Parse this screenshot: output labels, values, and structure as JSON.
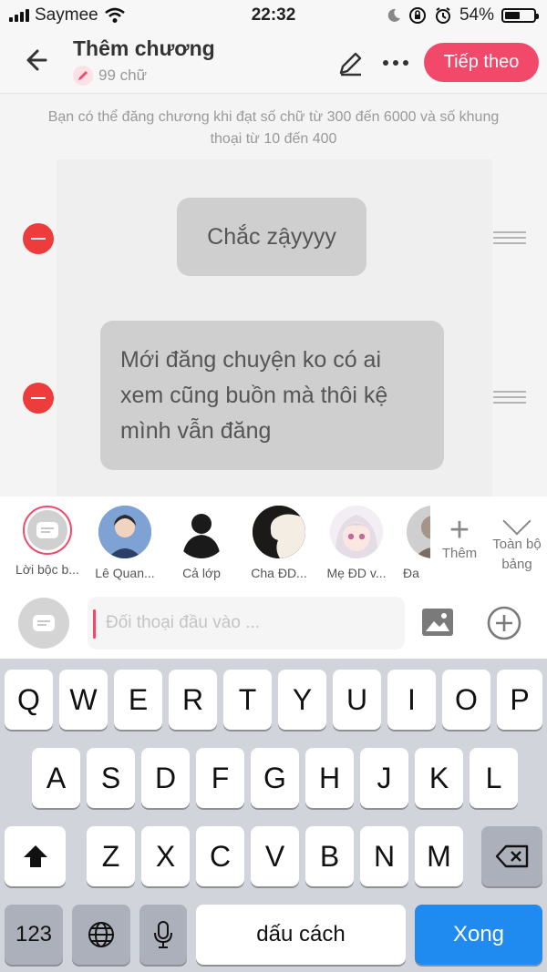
{
  "status_bar": {
    "carrier": "Saymee",
    "time": "22:32",
    "battery": "54%",
    "battery_level": 0.54
  },
  "header": {
    "title": "Thêm chương",
    "word_count": "99 chữ",
    "next_label": "Tiếp theo"
  },
  "notice": "Bạn có thể đăng chương khi đạt số chữ từ 300 đến 6000 và số khung thoại từ 10 đến 400",
  "dialogues": [
    {
      "text": "Chắc zậyyyy"
    },
    {
      "text": "Mới đăng chuyện ko có ai xem cũng buồn mà thôi kệ mình vẫn đăng"
    }
  ],
  "characters": [
    {
      "label": "Lời bộc b..."
    },
    {
      "label": "Lê Quan..."
    },
    {
      "label": "Cả lớp"
    },
    {
      "label": "Cha ĐD..."
    },
    {
      "label": "Mẹ ĐD v..."
    },
    {
      "label": "Đa"
    }
  ],
  "add_character_label": "Thêm",
  "all_characters_label": "Toàn bộ bảng",
  "input": {
    "placeholder": "Đối thoại đầu vào ..."
  },
  "keyboard": {
    "row1": [
      "Q",
      "W",
      "E",
      "R",
      "T",
      "Y",
      "U",
      "I",
      "O",
      "P"
    ],
    "row2": [
      "A",
      "S",
      "D",
      "F",
      "G",
      "H",
      "J",
      "K",
      "L"
    ],
    "row3": [
      "Z",
      "X",
      "C",
      "V",
      "B",
      "N",
      "M"
    ],
    "numbers_label": "123",
    "space_label": "dấu cách",
    "done_label": "Xong"
  },
  "colors": {
    "accent": "#f2496b",
    "remove": "#ee3b3b",
    "keyboard_bg": "#d1d4da",
    "done_key": "#1f8af0"
  }
}
